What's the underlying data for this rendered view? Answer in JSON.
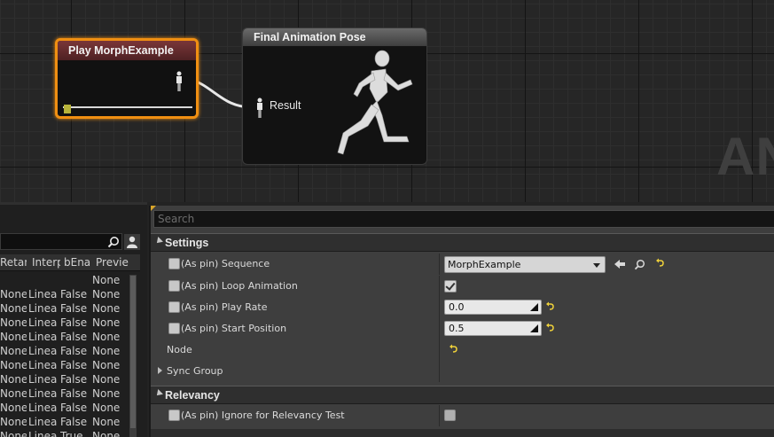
{
  "graph": {
    "watermark": "AN",
    "play_node": {
      "title": "Play MorphExample"
    },
    "final_node": {
      "title": "Final Animation Pose",
      "pin_label": "Result"
    }
  },
  "left_panel": {
    "search": {
      "value": "",
      "placeholder": ""
    },
    "columns": [
      "Retar",
      "Interp",
      "bEna",
      "Previe"
    ],
    "rows": [
      [
        "",
        "",
        "",
        "None"
      ],
      [
        "None",
        "Linea",
        "False",
        "None"
      ],
      [
        "None",
        "Linea",
        "False",
        "None"
      ],
      [
        "None",
        "Linea",
        "False",
        "None"
      ],
      [
        "None",
        "Linea",
        "False",
        "None"
      ],
      [
        "None",
        "Linea",
        "False",
        "None"
      ],
      [
        "None",
        "Linea",
        "False",
        "None"
      ],
      [
        "None",
        "Linea",
        "False",
        "None"
      ],
      [
        "None",
        "Linea",
        "False",
        "None"
      ],
      [
        "None",
        "Linea",
        "False",
        "None"
      ],
      [
        "None",
        "Linea",
        "False",
        "None"
      ],
      [
        "None",
        "Linea",
        "True",
        "None"
      ]
    ]
  },
  "details": {
    "search": {
      "placeholder": "Search"
    },
    "settings": {
      "label": "Settings",
      "sequence": {
        "label": "(As pin) Sequence",
        "value": "MorphExample"
      },
      "loop_animation": {
        "label": "(As pin) Loop Animation",
        "checked": true
      },
      "play_rate": {
        "label": "(As pin) Play Rate",
        "value": "0.0"
      },
      "start_position": {
        "label": "(As pin) Start Position",
        "value": "0.5"
      },
      "node": {
        "label": "Node"
      },
      "sync_group": {
        "label": "Sync Group"
      }
    },
    "relevancy": {
      "label": "Relevancy",
      "ignore": {
        "label": "(As pin) Ignore for Relevancy Test",
        "checked": false
      }
    },
    "icons": {
      "reset": "reset-arrow-icon",
      "use_selected": "left-arrow-icon",
      "browse": "magnifier-icon"
    }
  }
}
